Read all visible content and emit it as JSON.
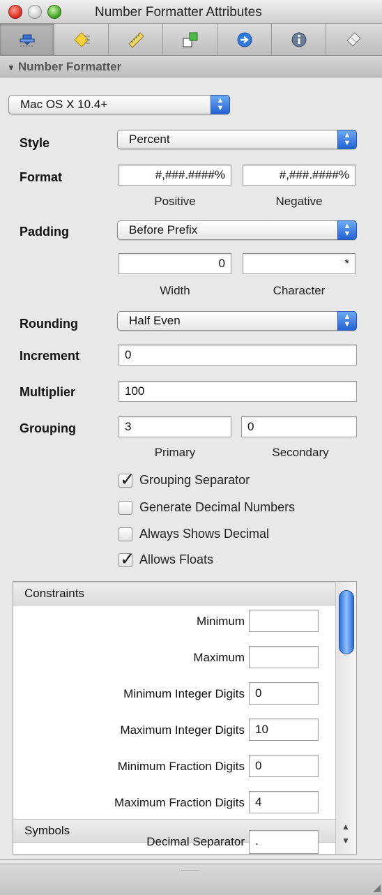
{
  "window": {
    "title": "Number Formatter Attributes"
  },
  "toolbar": {
    "tools": [
      {
        "icon": "attributes-icon"
      },
      {
        "icon": "effects-icon"
      },
      {
        "icon": "size-ruler-icon"
      },
      {
        "icon": "connections-icon"
      },
      {
        "icon": "bindings-icon"
      },
      {
        "icon": "identity-icon"
      },
      {
        "icon": "applescript-icon"
      }
    ]
  },
  "section": {
    "title": "Number Formatter"
  },
  "behavior": {
    "value": "Mac OS X 10.4+"
  },
  "style": {
    "label": "Style",
    "value": "Percent"
  },
  "format": {
    "label": "Format",
    "positive": "#,###.####%",
    "negative": "#,###.####%",
    "positive_caption": "Positive",
    "negative_caption": "Negative"
  },
  "padding": {
    "label": "Padding",
    "value": "Before Prefix",
    "width": "0",
    "character": "*",
    "width_caption": "Width",
    "character_caption": "Character"
  },
  "rounding": {
    "label": "Rounding",
    "value": "Half Even"
  },
  "increment": {
    "label": "Increment",
    "value": "0"
  },
  "multiplier": {
    "label": "Multiplier",
    "value": "100"
  },
  "grouping": {
    "label": "Grouping",
    "primary": "3",
    "secondary": "0",
    "primary_caption": "Primary",
    "secondary_caption": "Secondary"
  },
  "checks": [
    {
      "label": "Grouping Separator",
      "checked": true
    },
    {
      "label": "Generate Decimal Numbers",
      "checked": false
    },
    {
      "label": "Always Shows Decimal",
      "checked": false
    },
    {
      "label": "Allows Floats",
      "checked": true
    }
  ],
  "constraints": {
    "title": "Constraints",
    "rows": [
      {
        "label": "Minimum",
        "value": ""
      },
      {
        "label": "Maximum",
        "value": ""
      },
      {
        "label": "Minimum Integer Digits",
        "value": "0"
      },
      {
        "label": "Maximum Integer Digits",
        "value": "10"
      },
      {
        "label": "Minimum Fraction Digits",
        "value": "0"
      },
      {
        "label": "Maximum Fraction Digits",
        "value": "4"
      }
    ]
  },
  "symbols": {
    "title": "Symbols",
    "rows": [
      {
        "label": "Decimal Separator",
        "value": "."
      }
    ]
  }
}
